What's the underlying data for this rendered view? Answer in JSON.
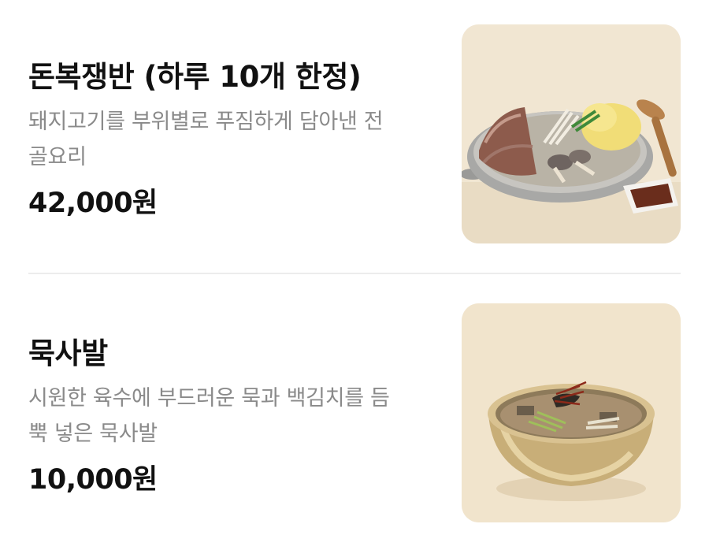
{
  "menu": {
    "items": [
      {
        "name": "돈복쟁반 (하루 10개 한정)",
        "description_lines": [
          "돼지고기를 부위별로 푸짐하게 담아낸 전",
          "골요리"
        ],
        "price": "42,000원",
        "image_icon": "hot-pot-platter-photo"
      },
      {
        "name": "묵사발",
        "description_lines": [
          "시원한 육수에 부드러운 묵과 백김치를 듬",
          "뿍 넣은 묵사발"
        ],
        "price": "10,000원",
        "image_icon": "acorn-jelly-soup-bowl-photo"
      }
    ]
  },
  "colors": {
    "name_text": "#111111",
    "description_text": "#8a8a8a",
    "price_text": "#111111",
    "divider": "#ececec",
    "thumb_background": "#f1e8d7"
  }
}
